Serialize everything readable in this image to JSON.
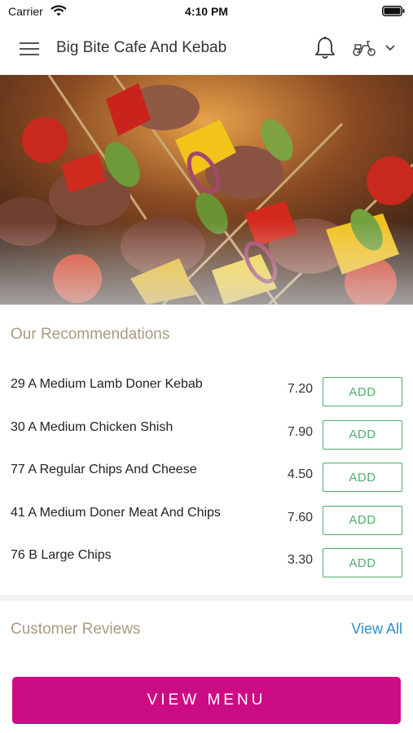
{
  "status_bar": {
    "carrier": "Carrier",
    "time": "4:10 PM"
  },
  "header": {
    "title": "Big Bite Cafe And Kebab",
    "icons": [
      "menu-icon",
      "bell-icon",
      "scooter-delivery-icon",
      "chevron-down-icon"
    ]
  },
  "hero": {
    "image": "grilled kebab skewers with peppers, onions and tomatoes"
  },
  "recommendations": {
    "title": "Our Recommendations",
    "add_label": "ADD",
    "items": [
      {
        "name": "29 A Medium Lamb Doner Kebab",
        "price": "7.20"
      },
      {
        "name": "30 A Medium Chicken Shish",
        "price": "7.90"
      },
      {
        "name": "77 A Regular Chips And Cheese",
        "price": "4.50"
      },
      {
        "name": "41 A Medium Doner Meat And Chips",
        "price": "7.60"
      },
      {
        "name": "76 B Large Chips",
        "price": "3.30"
      }
    ]
  },
  "reviews": {
    "title": "Customer Reviews",
    "view_all": "View All"
  },
  "cta": {
    "label": "VIEW MENU"
  },
  "colors": {
    "section_title": "#a89b80",
    "add_button": "#4caf6b",
    "link": "#2f8fc7",
    "cta_background": "#cc0c85"
  }
}
